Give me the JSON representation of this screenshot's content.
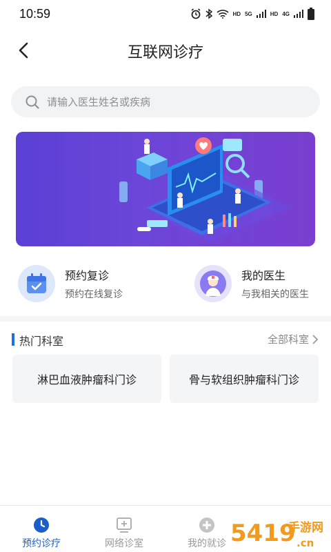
{
  "status_bar": {
    "time": "10:59",
    "network_labels": [
      "HD",
      "5G",
      "HD",
      "4G"
    ]
  },
  "header": {
    "title": "互联网诊疗"
  },
  "search": {
    "placeholder": "请输入医生姓名或疾病"
  },
  "quick_entries": [
    {
      "title": "预约复诊",
      "subtitle": "预约在线复诊",
      "icon": "calendar-check-icon"
    },
    {
      "title": "我的医生",
      "subtitle": "与我相关的医生",
      "icon": "doctor-avatar-icon"
    }
  ],
  "departments": {
    "title": "热门科室",
    "more_label": "全部科室",
    "items": [
      "淋巴血液肿瘤科门诊",
      "骨与软组织肿瘤科门诊"
    ]
  },
  "tabs": [
    {
      "label": "预约诊疗",
      "icon": "clock-icon",
      "active": true
    },
    {
      "label": "网络诊室",
      "icon": "monitor-plus-icon",
      "active": false
    },
    {
      "label": "我的就诊",
      "icon": "medical-cross-icon",
      "active": false
    },
    {
      "label": "",
      "icon": "user-icon",
      "active": false
    }
  ],
  "watermark": {
    "number": "5419",
    "text": "手游网",
    "domain": ".cn"
  },
  "colors": {
    "accent": "#1a5fc8",
    "banner_start": "#5b3fd6",
    "banner_end": "#7a3fd0",
    "watermark_orange": "#f29a1e"
  }
}
